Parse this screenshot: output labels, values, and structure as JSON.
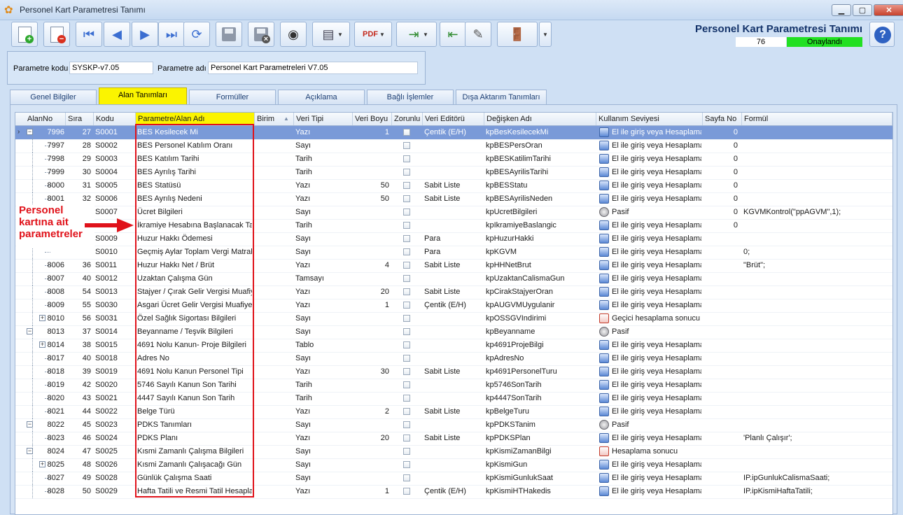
{
  "window": {
    "title": "Personel Kart Parametresi Tanımı",
    "min": "▁",
    "max": "▢",
    "close": "✕"
  },
  "header": {
    "title": "Personel Kart Parametresi Tanımı",
    "count": "76",
    "status": "Onaylandı"
  },
  "params": {
    "code_label": "Parametre kodu",
    "code_value": "SYSKP-v7.05",
    "name_label": "Parametre adı",
    "name_value": "Personel Kart Parametreleri V7.05"
  },
  "tabs": [
    "Genel Bilgiler",
    "Alan Tanımları",
    "Formüller",
    "Açıklama",
    "Bağlı İşlemler",
    "Dışa Aktarım Tanımları"
  ],
  "columns": [
    "AlanNo",
    "Sıra",
    "Kodu",
    "Parametre/Alan Adı",
    "Birim",
    "Veri Tipi",
    "Veri Boyu",
    "Zorunlu",
    "Veri Editörü",
    "Değişken Adı",
    "Kullanım Seviyesi",
    "Sayfa No",
    "Formül"
  ],
  "annotation": "Personel kartına ait parametreler",
  "rows": [
    {
      "alan": "7996",
      "sira": "27",
      "kodu": "S0001",
      "ad": "BES Kesilecek Mi",
      "tip": "Yazı",
      "boy": "1",
      "editor": "Çentik (E/H)",
      "degisken": "kpBesKesilecekMi",
      "seviye": "El ile giriş veya Hesaplama",
      "sayfa": "0",
      "formul": ""
    },
    {
      "alan": "7997",
      "sira": "28",
      "kodu": "S0002",
      "ad": "BES Personel Katılım Oranı",
      "tip": "Sayı",
      "boy": "",
      "editor": "",
      "degisken": "kpBESPersOran",
      "seviye": "El ile giriş veya Hesaplama",
      "sayfa": "0",
      "formul": ""
    },
    {
      "alan": "7998",
      "sira": "29",
      "kodu": "S0003",
      "ad": "BES Katılım Tarihi",
      "tip": "Tarih",
      "boy": "",
      "editor": "",
      "degisken": "kpBESKatilimTarihi",
      "seviye": "El ile giriş veya Hesaplama",
      "sayfa": "0",
      "formul": ""
    },
    {
      "alan": "7999",
      "sira": "30",
      "kodu": "S0004",
      "ad": "BES Ayrılış Tarihi",
      "tip": "Tarih",
      "boy": "",
      "editor": "",
      "degisken": "kpBESAyrilisTarihi",
      "seviye": "El ile giriş veya Hesaplama",
      "sayfa": "0",
      "formul": ""
    },
    {
      "alan": "8000",
      "sira": "31",
      "kodu": "S0005",
      "ad": "BES Statüsü",
      "tip": "Yazı",
      "boy": "50",
      "editor": "Sabit Liste",
      "degisken": "kpBESStatu",
      "seviye": "El ile giriş veya Hesaplama",
      "sayfa": "0",
      "formul": ""
    },
    {
      "alan": "8001",
      "sira": "32",
      "kodu": "S0006",
      "ad": "BES Ayrılış Nedeni",
      "tip": "Yazı",
      "boy": "50",
      "editor": "Sabit Liste",
      "degisken": "kpBESAyrilisNeden",
      "seviye": "El ile giriş veya Hesaplama",
      "sayfa": "0",
      "formul": ""
    },
    {
      "alan": "",
      "sira": "",
      "kodu": "S0007",
      "ad": "Ücret Bilgileri",
      "tip": "Sayı",
      "boy": "",
      "editor": "",
      "degisken": "kpUcretBilgileri",
      "seviye": "Pasif",
      "sayfa": "0",
      "formul": "KGVMKontrol(\"ppAGVM\",1);"
    },
    {
      "alan": "",
      "sira": "",
      "kodu": "",
      "ad": "İkramiye Hesabına Başlanacak Tarih",
      "tip": "Tarih",
      "boy": "",
      "editor": "",
      "degisken": "kpIkramiyeBaslangic",
      "seviye": "El ile giriş veya Hesaplama",
      "sayfa": "0",
      "formul": ""
    },
    {
      "alan": "",
      "sira": "",
      "kodu": "S0009",
      "ad": "Huzur Hakkı Ödemesi",
      "tip": "Sayı",
      "boy": "",
      "editor": "Para",
      "degisken": "kpHuzurHakki",
      "seviye": "El ile giriş veya Hesaplama",
      "sayfa": "",
      "formul": ""
    },
    {
      "alan": "",
      "sira": "",
      "kodu": "S0010",
      "ad": "Geçmiş Aylar Toplam Vergi Matrahı",
      "tip": "Sayı",
      "boy": "",
      "editor": "Para",
      "degisken": "kpKGVM",
      "seviye": "El ile giriş veya Hesaplama",
      "sayfa": "",
      "formul": "0;"
    },
    {
      "alan": "8006",
      "sira": "36",
      "kodu": "S0011",
      "ad": "Huzur Hakkı Net / Brüt",
      "tip": "Yazı",
      "boy": "4",
      "editor": "Sabit Liste",
      "degisken": "kpHHNetBrut",
      "seviye": "El ile giriş veya Hesaplama",
      "sayfa": "",
      "formul": "\"Brüt\";"
    },
    {
      "alan": "8007",
      "sira": "40",
      "kodu": "S0012",
      "ad": "Uzaktan Çalışma Gün",
      "tip": "Tamsayı",
      "boy": "",
      "editor": "",
      "degisken": "kpUzaktanCalismaGun",
      "seviye": "El ile giriş veya Hesaplama",
      "sayfa": "",
      "formul": ""
    },
    {
      "alan": "8008",
      "sira": "54",
      "kodu": "S0013",
      "ad": "Stajyer / Çırak Gelir Vergisi Muafiyeti",
      "tip": "Yazı",
      "boy": "20",
      "editor": "Sabit Liste",
      "degisken": "kpCirakStajyerOran",
      "seviye": "El ile giriş veya Hesaplama",
      "sayfa": "",
      "formul": ""
    },
    {
      "alan": "8009",
      "sira": "55",
      "kodu": "S0030",
      "ad": "Asgari Ücret Gelir Vergisi Muafiyeti",
      "tip": "Yazı",
      "boy": "1",
      "editor": "Çentik (E/H)",
      "degisken": "kpAUGVMUygulanir",
      "seviye": "El ile giriş veya Hesaplama",
      "sayfa": "",
      "formul": ""
    },
    {
      "alan": "8010",
      "sira": "56",
      "kodu": "S0031",
      "ad": "Özel Sağlık Sigortası Bilgileri",
      "tip": "Sayı",
      "boy": "",
      "editor": "",
      "degisken": "kpOSSGVIndirimi",
      "seviye": "Geçici hesaplama sonucu",
      "sayfa": "",
      "formul": ""
    },
    {
      "alan": "8013",
      "sira": "37",
      "kodu": "S0014",
      "ad": "Beyanname / Teşvik Bilgileri",
      "tip": "Sayı",
      "boy": "",
      "editor": "",
      "degisken": "kpBeyanname",
      "seviye": "Pasif",
      "sayfa": "",
      "formul": ""
    },
    {
      "alan": "8014",
      "sira": "38",
      "kodu": "S0015",
      "ad": "4691 Nolu Kanun- Proje Bilgileri",
      "tip": "Tablo",
      "boy": "",
      "editor": "",
      "degisken": "kp4691ProjeBilgi",
      "seviye": "El ile giriş veya Hesaplama",
      "sayfa": "",
      "formul": ""
    },
    {
      "alan": "8017",
      "sira": "40",
      "kodu": "S0018",
      "ad": "Adres No",
      "tip": "Sayı",
      "boy": "",
      "editor": "",
      "degisken": "kpAdresNo",
      "seviye": "El ile giriş veya Hesaplama",
      "sayfa": "",
      "formul": ""
    },
    {
      "alan": "8018",
      "sira": "39",
      "kodu": "S0019",
      "ad": "4691 Nolu Kanun Personel Tipi",
      "tip": "Yazı",
      "boy": "30",
      "editor": "Sabit Liste",
      "degisken": "kp4691PersonelTuru",
      "seviye": "El ile giriş veya Hesaplama",
      "sayfa": "",
      "formul": ""
    },
    {
      "alan": "8019",
      "sira": "42",
      "kodu": "S0020",
      "ad": "5746 Sayılı Kanun Son Tarihi",
      "tip": "Tarih",
      "boy": "",
      "editor": "",
      "degisken": "kp5746SonTarih",
      "seviye": "El ile giriş veya Hesaplama",
      "sayfa": "",
      "formul": ""
    },
    {
      "alan": "8020",
      "sira": "43",
      "kodu": "S0021",
      "ad": "4447 Sayılı Kanun Son Tarih",
      "tip": "Tarih",
      "boy": "",
      "editor": "",
      "degisken": "kp4447SonTarih",
      "seviye": "El ile giriş veya Hesaplama",
      "sayfa": "",
      "formul": ""
    },
    {
      "alan": "8021",
      "sira": "44",
      "kodu": "S0022",
      "ad": "Belge Türü",
      "tip": "Yazı",
      "boy": "2",
      "editor": "Sabit Liste",
      "degisken": "kpBelgeTuru",
      "seviye": "El ile giriş veya Hesaplama",
      "sayfa": "",
      "formul": ""
    },
    {
      "alan": "8022",
      "sira": "45",
      "kodu": "S0023",
      "ad": "PDKS Tanımları",
      "tip": "Sayı",
      "boy": "",
      "editor": "",
      "degisken": "kpPDKSTanim",
      "seviye": "Pasif",
      "sayfa": "",
      "formul": ""
    },
    {
      "alan": "8023",
      "sira": "46",
      "kodu": "S0024",
      "ad": "PDKS Planı",
      "tip": "Yazı",
      "boy": "20",
      "editor": "Sabit Liste",
      "degisken": "kpPDKSPlan",
      "seviye": "El ile giriş veya Hesaplama",
      "sayfa": "",
      "formul": "'Planlı Çalışır';"
    },
    {
      "alan": "8024",
      "sira": "47",
      "kodu": "S0025",
      "ad": "Kısmi Zamanlı Çalışma Bilgileri",
      "tip": "Sayı",
      "boy": "",
      "editor": "",
      "degisken": "kpKismiZamanBilgi",
      "seviye": "Hesaplama sonucu",
      "sayfa": "",
      "formul": ""
    },
    {
      "alan": "8025",
      "sira": "48",
      "kodu": "S0026",
      "ad": "Kısmi Zamanlı Çalışacağı Gün",
      "tip": "Sayı",
      "boy": "",
      "editor": "",
      "degisken": "kpKismiGun",
      "seviye": "El ile giriş veya Hesaplama",
      "sayfa": "",
      "formul": ""
    },
    {
      "alan": "8027",
      "sira": "49",
      "kodu": "S0028",
      "ad": "Günlük Çalışma Saati",
      "tip": "Sayı",
      "boy": "",
      "editor": "",
      "degisken": "kpKismiGunlukSaat",
      "seviye": "El ile giriş veya Hesaplama",
      "sayfa": "",
      "formul": "IP.ipGunlukCalismaSaati;"
    },
    {
      "alan": "8028",
      "sira": "50",
      "kodu": "S0029",
      "ad": "Hafta Tatili ve Resmi Tatil Hesaplan",
      "tip": "Yazı",
      "boy": "1",
      "editor": "Çentik (E/H)",
      "degisken": "kpKismiHTHakedis",
      "seviye": "El ile giriş veya Hesaplama",
      "sayfa": "",
      "formul": "IP.ipKismiHaftaTatili;"
    }
  ]
}
